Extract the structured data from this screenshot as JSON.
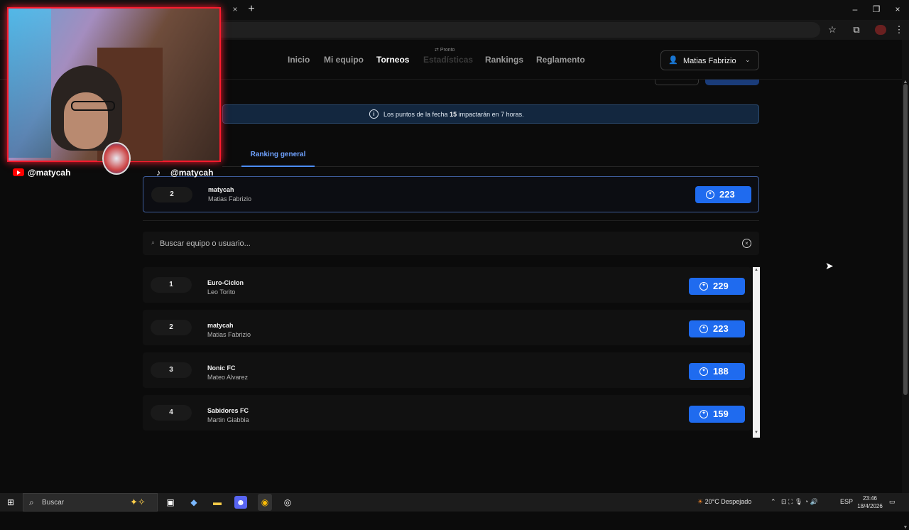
{
  "browser": {
    "tab_close": "×",
    "new_tab": "+",
    "window_controls": [
      "–",
      "❐",
      "×"
    ]
  },
  "nav": {
    "links": [
      {
        "label": "Inicio",
        "state": "normal"
      },
      {
        "label": "Mi equipo",
        "state": "normal"
      },
      {
        "label": "Torneos",
        "state": "active"
      },
      {
        "label": "Estadísticas",
        "state": "disabled"
      },
      {
        "label": "Rankings",
        "state": "normal"
      },
      {
        "label": "Reglamento",
        "state": "normal"
      }
    ],
    "soon_badge": "Pronto",
    "user_name": "Matias Fabrizio"
  },
  "info_banner": {
    "text_before": "Los puntos de la fecha ",
    "round": "15",
    "text_after": " impactarán en 7 horas."
  },
  "tabs": {
    "active": "Ranking general"
  },
  "my_entry": {
    "position": "2",
    "team": "matycah",
    "user": "Matias Fabrizio",
    "points": "223"
  },
  "search": {
    "placeholder": "Buscar equipo o usuario..."
  },
  "ranking": [
    {
      "position": "1",
      "team": "Euro-Ciclon",
      "user": "Leo Torito",
      "points": "229"
    },
    {
      "position": "2",
      "team": "matycah",
      "user": "Matias Fabrizio",
      "points": "223"
    },
    {
      "position": "3",
      "team": "Nonic FC",
      "user": "Mateo Alvarez",
      "points": "188"
    },
    {
      "position": "4",
      "team": "Sabidores FC",
      "user": "Martin Giabbia",
      "points": "159"
    }
  ],
  "overlay": {
    "youtube_handle": "@matycah",
    "tiktok_handle": "@matycah"
  },
  "taskbar": {
    "search_label": "Buscar",
    "weather": "20°C  Despejado",
    "language": "ESP",
    "time": "23:46",
    "date": "18/4/2026"
  },
  "colors": {
    "accent": "#1f6bef",
    "active_tab": "#6fa2ff",
    "banner_bg": "#13273f",
    "cam_border": "#ff1a2d"
  }
}
